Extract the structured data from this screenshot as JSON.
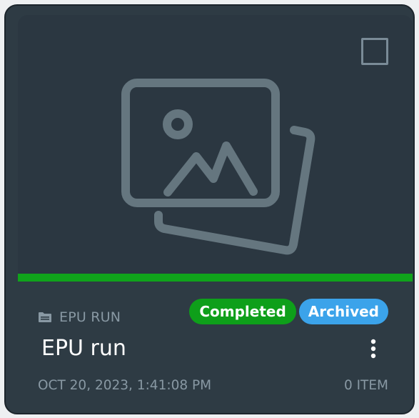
{
  "card": {
    "type_label": "EPU RUN",
    "type_icon": "folder-icon",
    "title": "EPU run",
    "date": "OCT 20, 2023, 1:41:08 PM",
    "item_count": "0 ITEM",
    "badges": {
      "completed": "Completed",
      "archived": "Archived"
    },
    "thumbnail_icon": "image-gallery-placeholder-icon",
    "selected": false
  },
  "colors": {
    "card_background": "#2e3b44",
    "status_bar": "#10a31b",
    "completed_badge": "#0e9f1a",
    "archived_badge": "#3ba3ea",
    "muted_text": "#8898a3"
  }
}
